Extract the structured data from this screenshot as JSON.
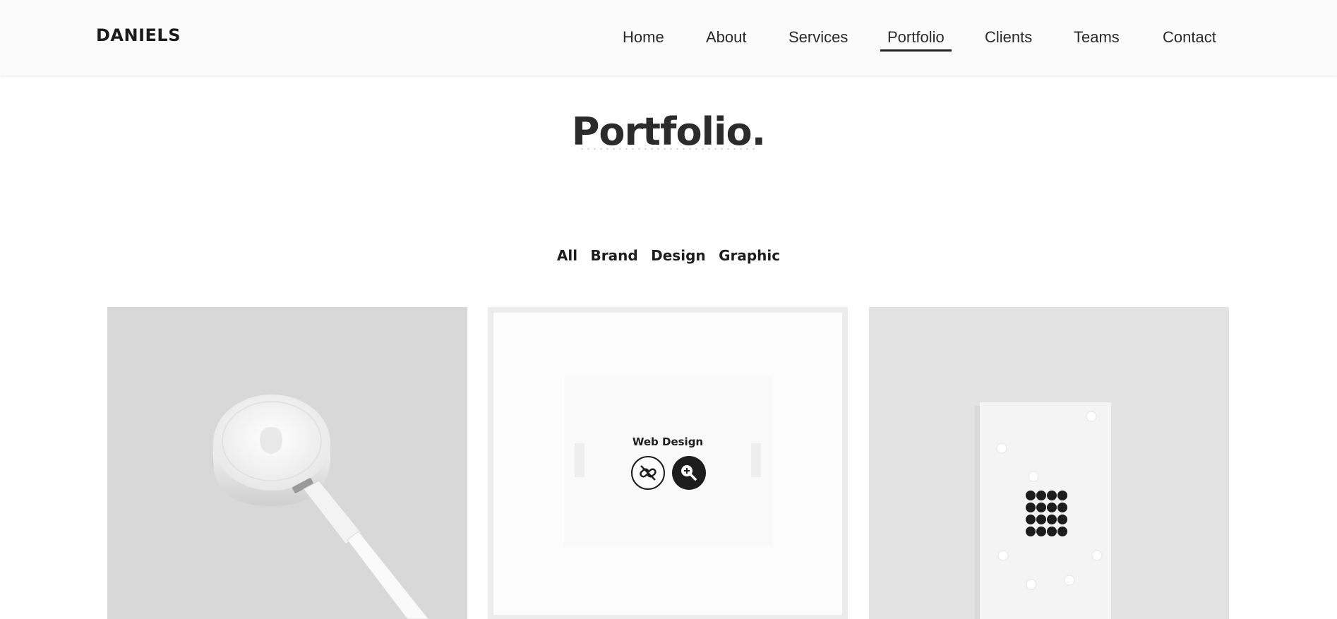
{
  "header": {
    "logo": "DANIELS",
    "nav": [
      {
        "label": "Home",
        "active": false
      },
      {
        "label": "About",
        "active": false
      },
      {
        "label": "Services",
        "active": false
      },
      {
        "label": "Portfolio",
        "active": true
      },
      {
        "label": "Clients",
        "active": false
      },
      {
        "label": "Teams",
        "active": false
      },
      {
        "label": "Contact",
        "active": false
      }
    ]
  },
  "section": {
    "title": "Portfolio."
  },
  "filters": [
    "All",
    "Brand",
    "Design",
    "Graphic"
  ],
  "portfolio": {
    "items": [
      {
        "image": "watch-charger-photo"
      },
      {
        "image": "web-design-mockup",
        "hover_title": "Web Design",
        "actions": [
          "unlink-icon",
          "zoom-in-icon"
        ]
      },
      {
        "image": "business-card-photo"
      }
    ]
  },
  "colors": {
    "text_dark": "#222222",
    "nav_background": "#fbfbfb",
    "card_gray": "#d9d8d9",
    "accent": "#1d1d1d"
  }
}
